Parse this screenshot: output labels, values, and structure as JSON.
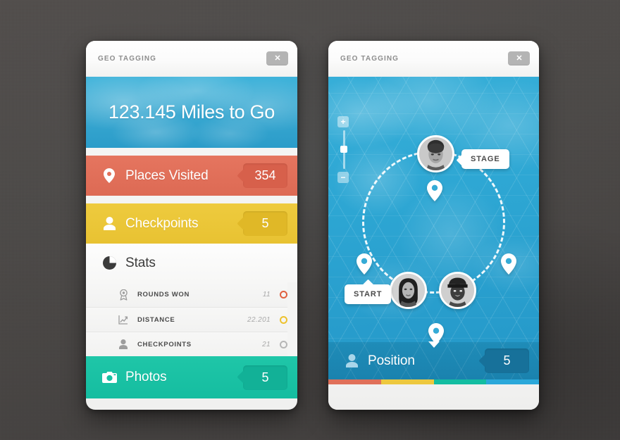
{
  "background": {
    "color": "#4a4745"
  },
  "left_card": {
    "header": {
      "title": "GEO TAGGING",
      "close_label": "✕"
    },
    "hero": {
      "text": "123.145 Miles to Go"
    },
    "rows": [
      {
        "icon": "map-pin-icon",
        "label": "Places Visited",
        "value": "354",
        "color": "#e0705a",
        "name": "places-visited"
      },
      {
        "icon": "person-icon",
        "label": "Checkpoints",
        "value": "5",
        "color": "#ecc53a",
        "name": "checkpoints"
      },
      {
        "icon": "pie-chart-icon",
        "label": "Stats",
        "value": "",
        "color": "#fafafa",
        "name": "stats"
      },
      {
        "icon": "camera-icon",
        "label": "Photos",
        "value": "5",
        "color": "#18c0a3",
        "name": "photos"
      }
    ],
    "stats_rows": [
      {
        "icon": "medal-icon",
        "label": "ROUNDS WON",
        "value": "11",
        "dot_color": "#e0603f"
      },
      {
        "icon": "line-chart-icon",
        "label": "DISTANCE",
        "value": "22.201",
        "dot_color": "#edc22e"
      },
      {
        "icon": "person-small-icon",
        "label": "CHECKPOINTS",
        "value": "21",
        "dot_color": "#b6b6b6"
      }
    ]
  },
  "right_card": {
    "header": {
      "title": "GEO TAGGING",
      "close_label": "✕"
    },
    "zoom_control": {
      "zoom_in_label": "+",
      "zoom_out_label": "−"
    },
    "tooltips": [
      {
        "label": "STAGE",
        "name": "stage-tooltip"
      },
      {
        "label": "START",
        "name": "start-tooltip"
      }
    ],
    "position_bar": {
      "icon": "person-icon",
      "label": "Position",
      "value": "5",
      "color": "#1a82ae"
    },
    "color_strip": [
      "#e0705a",
      "#edc83f",
      "#13bda2",
      "#2ba8da"
    ]
  }
}
